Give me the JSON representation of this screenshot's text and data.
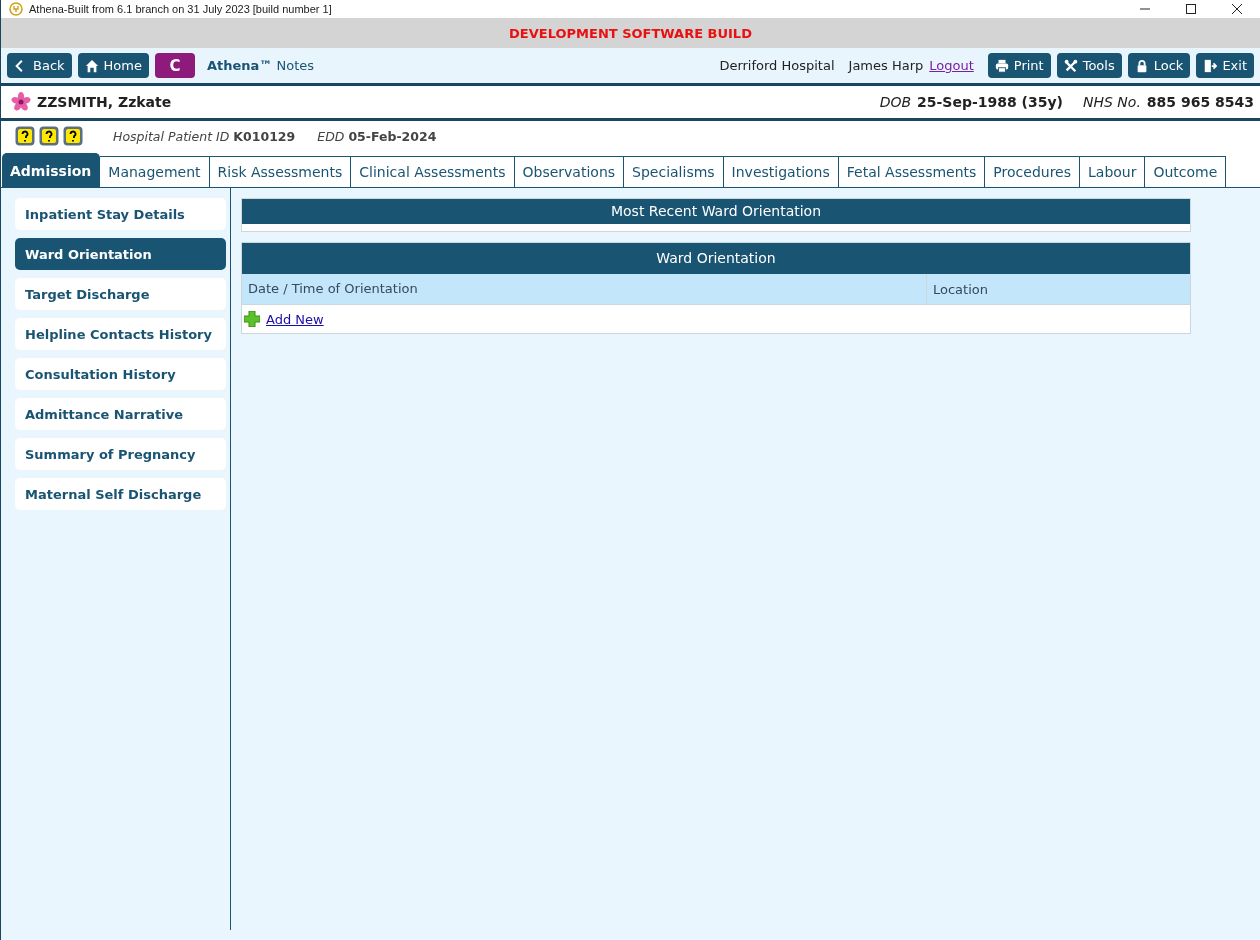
{
  "window": {
    "title": "Athena-Built from 6.1 branch on 31 July 2023 [build number 1]"
  },
  "banner": "DEVELOPMENT SOFTWARE BUILD",
  "toolbar": {
    "left_buttons": [
      "Back",
      "Home"
    ],
    "c_button": "C",
    "app_title": "**Athena™** Notes",
    "hospital": "Derriford Hospital",
    "user": "James Harp",
    "logout": "Logout",
    "right_buttons": [
      "Print",
      "Tools",
      "Lock",
      "Exit"
    ]
  },
  "patient": {
    "name": "ZZSMITH, Zzkate",
    "dob_label": "DOB",
    "dob": "25-Sep-1988 (35y)",
    "nhs_label": "NHS No.",
    "nhs": "885 965 8543"
  },
  "info": {
    "hospital_id_label": "Hospital Patient ID",
    "hospital_id": "K010129",
    "edd_label": "EDD",
    "edd": "05-Feb-2024"
  },
  "tabs": [
    {
      "label": "Admission",
      "selected": true
    },
    {
      "label": "Management",
      "selected": false
    },
    {
      "label": "Risk Assessments",
      "selected": false
    },
    {
      "label": "Clinical Assessments",
      "selected": false
    },
    {
      "label": "Observations",
      "selected": false
    },
    {
      "label": "Specialisms",
      "selected": false
    },
    {
      "label": "Investigations",
      "selected": false
    },
    {
      "label": "Fetal Assessments",
      "selected": false
    },
    {
      "label": "Procedures",
      "selected": false
    },
    {
      "label": "Labour",
      "selected": false
    },
    {
      "label": "Outcome",
      "selected": false
    }
  ],
  "sidebar": {
    "items": [
      {
        "label": "Inpatient Stay Details",
        "selected": false
      },
      {
        "label": "Ward Orientation",
        "selected": true
      },
      {
        "label": "Target Discharge",
        "selected": false
      },
      {
        "label": "Helpline Contacts History",
        "selected": false
      },
      {
        "label": "Consultation History",
        "selected": false
      },
      {
        "label": "Admittance Narrative",
        "selected": false
      },
      {
        "label": "Summary of Pregnancy",
        "selected": false
      },
      {
        "label": "Maternal Self Discharge",
        "selected": false
      }
    ]
  },
  "recent_panel": {
    "title": "Most Recent Ward Orientation"
  },
  "orientation_table": {
    "title": "Ward Orientation",
    "columns": [
      "Date / Time of Orientation",
      "Location"
    ],
    "add_link": "Add New"
  }
}
